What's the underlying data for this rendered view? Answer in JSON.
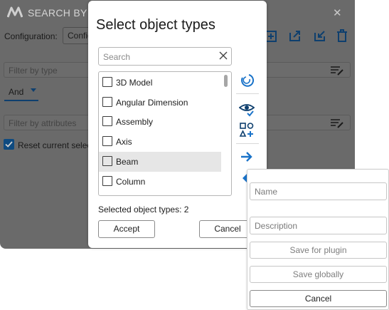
{
  "background_window": {
    "title": "SEARCH BY C",
    "configuration_label": "Configuration:",
    "configuration_value": "Config",
    "filter_by_type_placeholder": "Filter by type",
    "operator_value": "And",
    "filter_by_attributes_placeholder": "Filter by attributes",
    "reset_label": "Reset current selec",
    "reset_checked": true
  },
  "dialog": {
    "title": "Select object types",
    "search_placeholder": "Search",
    "items": [
      {
        "label": "3D Model",
        "checked": false,
        "highlighted": false
      },
      {
        "label": "Angular Dimension",
        "checked": false,
        "highlighted": false
      },
      {
        "label": "Assembly",
        "checked": false,
        "highlighted": false
      },
      {
        "label": "Axis",
        "checked": false,
        "highlighted": false
      },
      {
        "label": "Beam",
        "checked": false,
        "highlighted": true
      },
      {
        "label": "Column",
        "checked": false,
        "highlighted": false
      }
    ],
    "selected_count_label": "Selected object types: 2",
    "accept_label": "Accept",
    "cancel_label": "Cancel"
  },
  "save_popup": {
    "name_placeholder": "Name",
    "description_placeholder": "Description",
    "save_plugin_label": "Save for plugin",
    "save_global_label": "Save globally",
    "cancel_label": "Cancel"
  },
  "colors": {
    "accent_blue": "#1a73c9",
    "dark_blue": "#0e3f6e",
    "overlay_gray": "#6a6a6a"
  }
}
